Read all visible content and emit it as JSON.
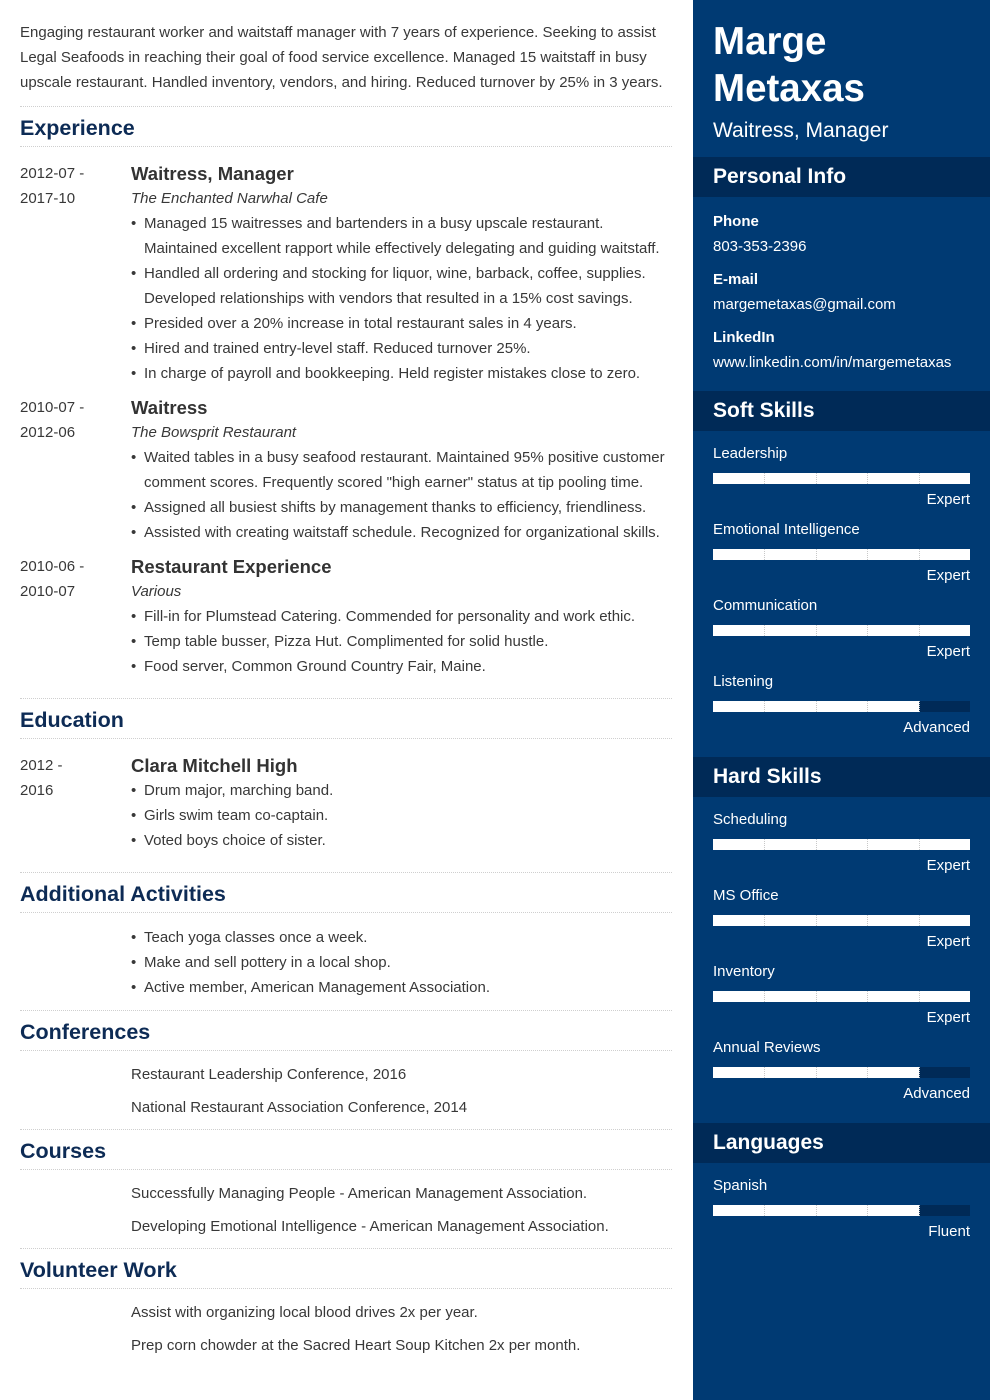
{
  "summary": "Engaging restaurant worker and waitstaff manager with 7 years of experience. Seeking to assist Legal Seafoods in reaching their goal of food service excellence. Managed 15 waitstaff in busy upscale restaurant. Handled inventory, vendors, and hiring. Reduced turnover by 25% in 3 years.",
  "experience": {
    "title": "Experience",
    "entries": [
      {
        "date_start": "2012-07 -",
        "date_end": "2017-10",
        "title": "Waitress, Manager",
        "employer": "The Enchanted Narwhal Cafe",
        "bullets": [
          "Managed 15 waitresses and bartenders in a busy upscale restaurant. Maintained excellent rapport while effectively delegating and guiding waitstaff.",
          "Handled all ordering and stocking for liquor, wine, barback, coffee, supplies. Developed relationships with vendors that resulted in a 15% cost savings.",
          "Presided over a 20% increase in total restaurant sales in 4 years.",
          "Hired and trained entry-level staff. Reduced turnover 25%.",
          "In charge of payroll and bookkeeping. Held register mistakes close to zero."
        ]
      },
      {
        "date_start": "2010-07 -",
        "date_end": "2012-06",
        "title": "Waitress",
        "employer": "The Bowsprit Restaurant",
        "bullets": [
          "Waited tables in a busy seafood restaurant. Maintained 95% positive customer comment scores. Frequently scored \"high earner\" status at tip pooling time.",
          "Assigned all busiest shifts by management thanks to efficiency, friendliness.",
          "Assisted with creating waitstaff schedule. Recognized for organizational skills."
        ]
      },
      {
        "date_start": "2010-06 -",
        "date_end": "2010-07",
        "title": "Restaurant Experience",
        "employer": "Various",
        "bullets": [
          "Fill-in for Plumstead Catering. Commended for personality and work ethic.",
          "Temp table busser, Pizza Hut. Complimented for solid hustle.",
          "Food server, Common Ground Country Fair, Maine."
        ]
      }
    ]
  },
  "education": {
    "title": "Education",
    "entries": [
      {
        "date_start": "2012 -",
        "date_end": "2016",
        "title": "Clara Mitchell High",
        "bullets": [
          "Drum major, marching band.",
          "Girls swim team co-captain.",
          "Voted boys choice of sister."
        ]
      }
    ]
  },
  "activities": {
    "title": "Additional Activities",
    "bullets": [
      "Teach yoga classes once a week.",
      "Make and sell pottery in a local shop.",
      "Active member, American Management Association."
    ]
  },
  "conferences": {
    "title": "Conferences",
    "items": [
      "Restaurant Leadership Conference, 2016",
      "National Restaurant Association Conference, 2014"
    ]
  },
  "courses": {
    "title": "Courses",
    "items": [
      "Successfully Managing People - American Management Association.",
      "Developing Emotional Intelligence - American Management Association."
    ]
  },
  "volunteer": {
    "title": "Volunteer Work",
    "items": [
      "Assist with organizing local blood drives 2x per year.",
      "Prep corn chowder at the Sacred Heart Soup Kitchen 2x per month."
    ]
  },
  "sidebar": {
    "first_name": "Marge",
    "last_name": "Metaxas",
    "role": "Waitress, Manager",
    "personal_info": {
      "title": "Personal Info",
      "fields": [
        {
          "label": "Phone",
          "value": "803-353-2396"
        },
        {
          "label": "E-mail",
          "value": "margemetaxas@gmail.com"
        },
        {
          "label": "LinkedIn",
          "value": "www.linkedin.com/in/margemetaxas"
        }
      ]
    },
    "soft_skills": {
      "title": "Soft Skills",
      "items": [
        {
          "name": "Leadership",
          "level": "Expert",
          "fraction": 1.0
        },
        {
          "name": "Emotional Intelligence",
          "level": "Expert",
          "fraction": 1.0
        },
        {
          "name": "Communication",
          "level": "Expert",
          "fraction": 1.0
        },
        {
          "name": "Listening",
          "level": "Advanced",
          "fraction": 0.8
        }
      ]
    },
    "hard_skills": {
      "title": "Hard Skills",
      "items": [
        {
          "name": "Scheduling",
          "level": "Expert",
          "fraction": 1.0
        },
        {
          "name": "MS Office",
          "level": "Expert",
          "fraction": 1.0
        },
        {
          "name": "Inventory",
          "level": "Expert",
          "fraction": 1.0
        },
        {
          "name": "Annual Reviews",
          "level": "Advanced",
          "fraction": 0.8
        }
      ]
    },
    "languages": {
      "title": "Languages",
      "items": [
        {
          "name": "Spanish",
          "level": "Fluent",
          "fraction": 0.8
        }
      ]
    }
  },
  "colors": {
    "sidebar_bg": "#003a73",
    "sidebar_header_bg": "#002a57",
    "heading_text": "#0d2b55",
    "body_text": "#383838"
  }
}
